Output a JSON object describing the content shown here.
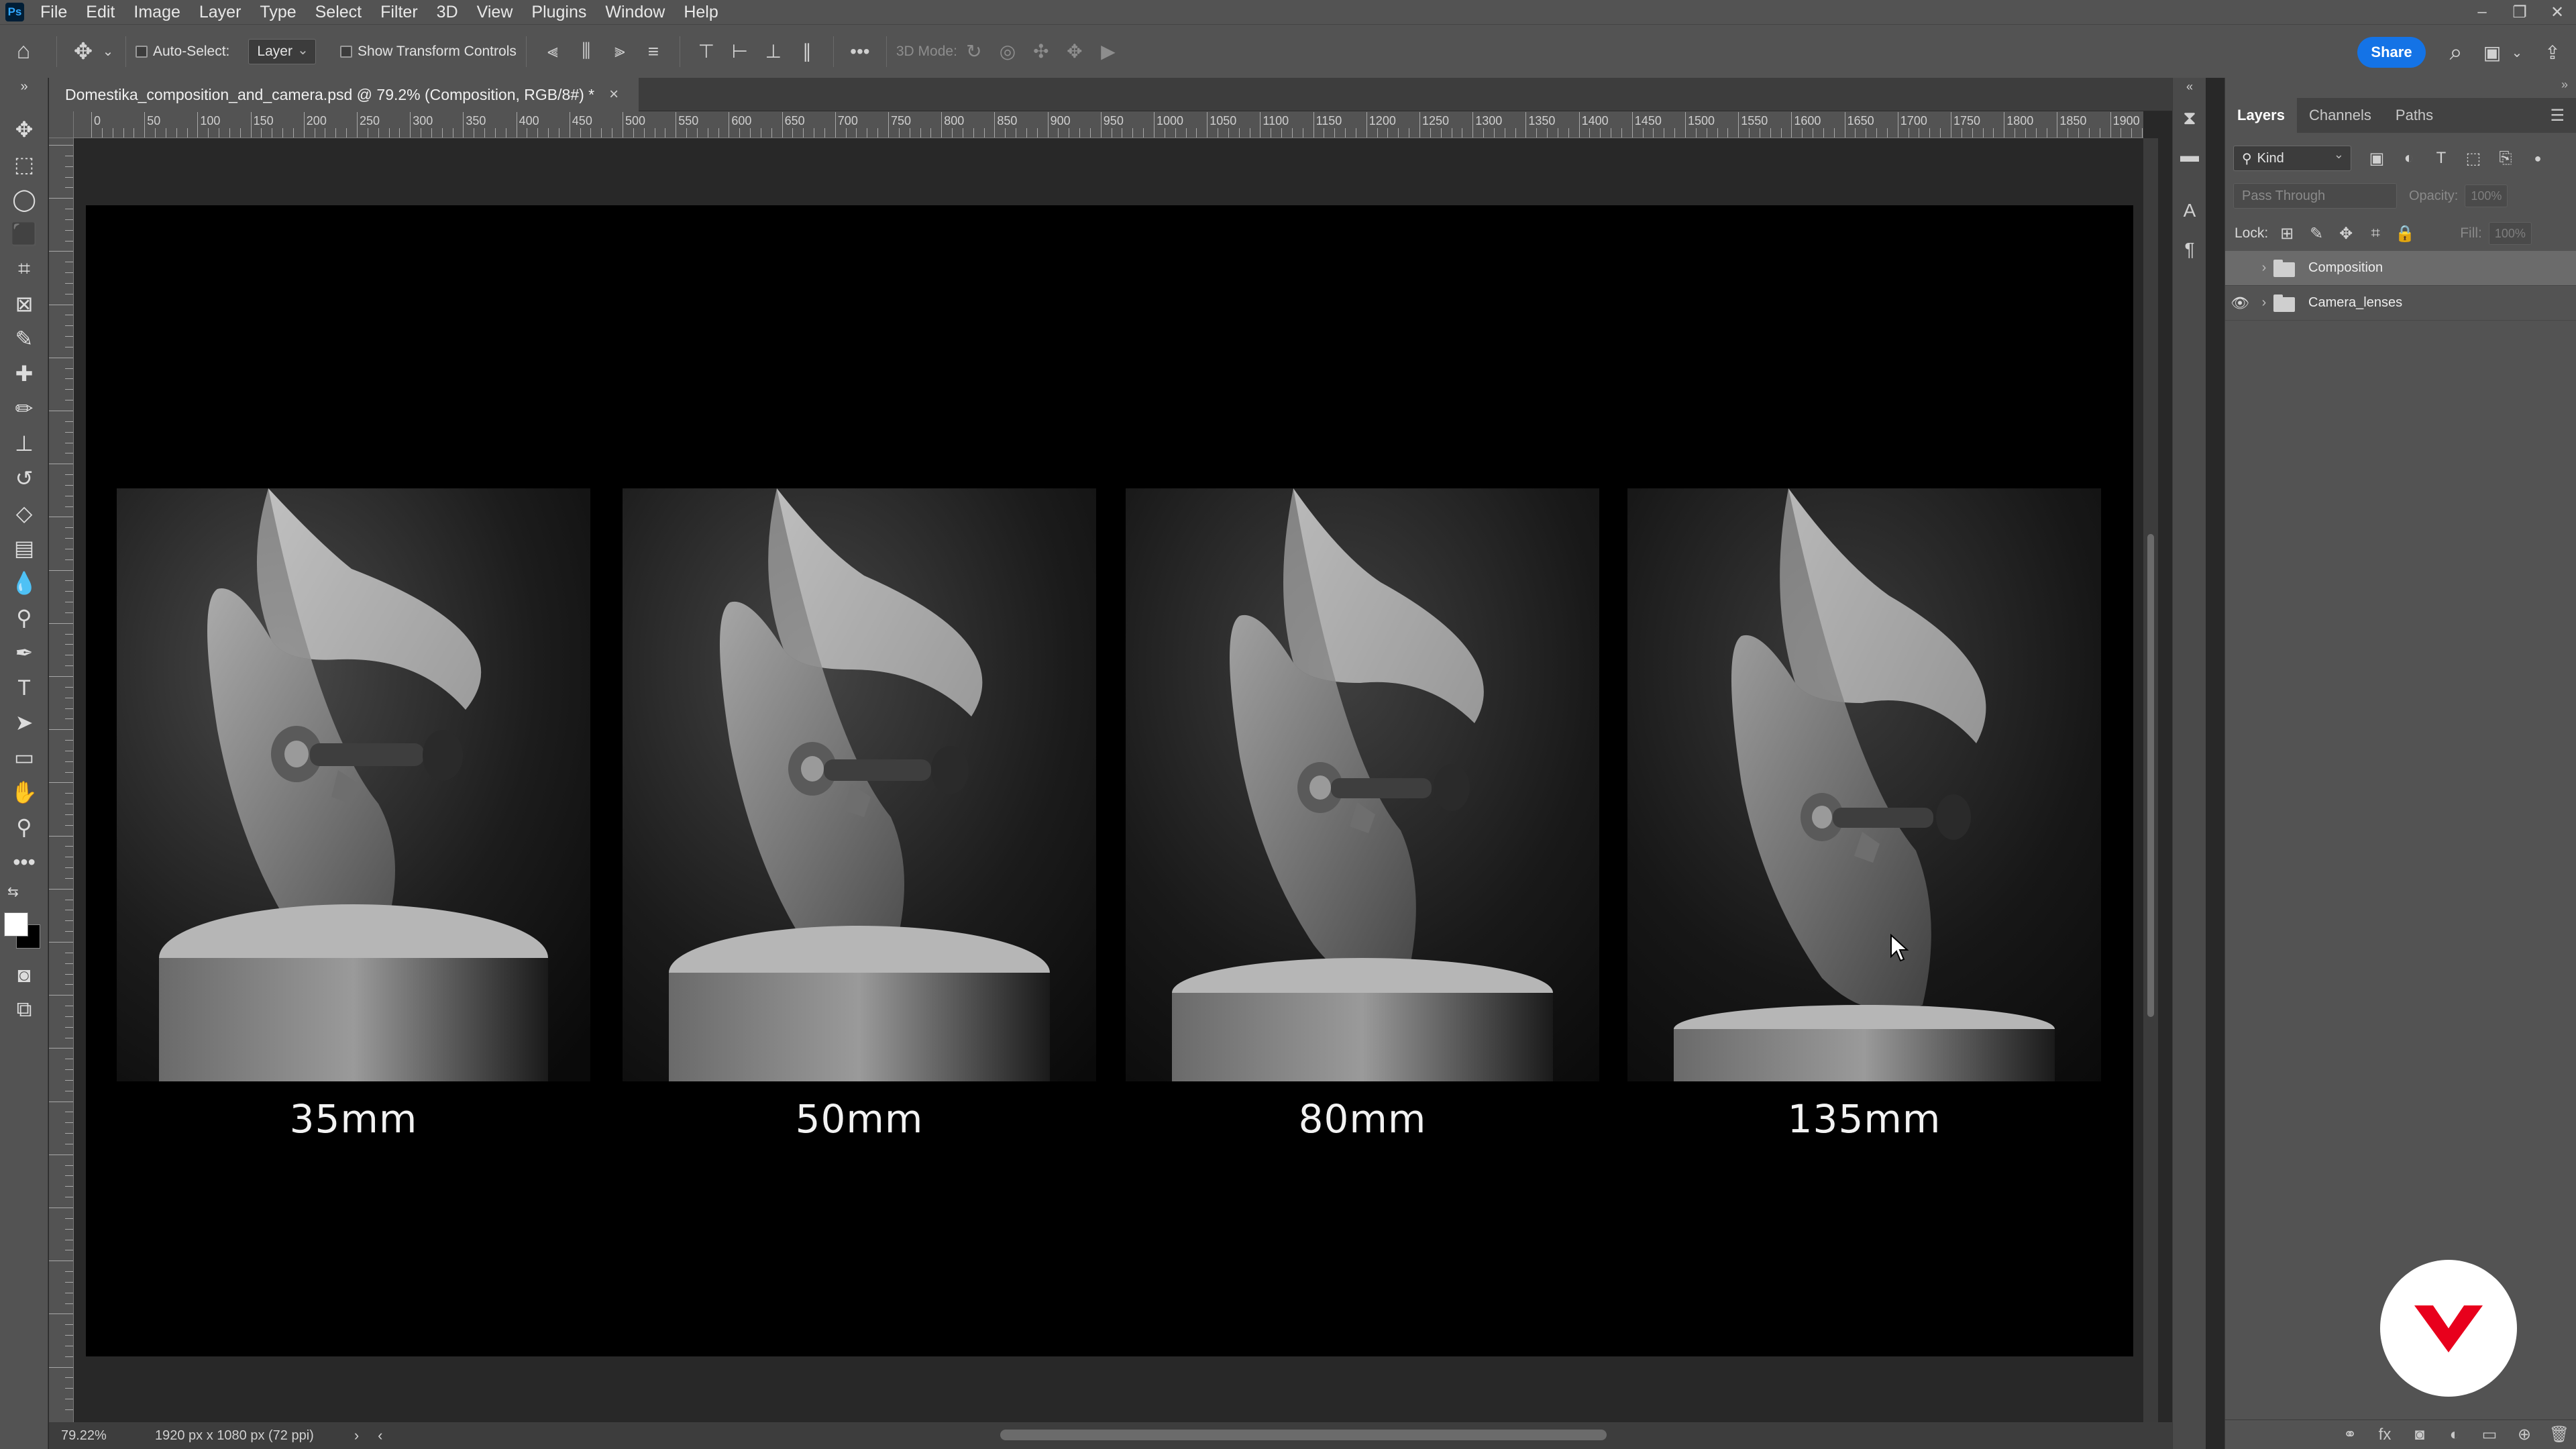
{
  "app": {
    "logo_text": "Ps",
    "menu": [
      "File",
      "Edit",
      "Image",
      "Layer",
      "Type",
      "Select",
      "Filter",
      "3D",
      "View",
      "Plugins",
      "Window",
      "Help"
    ]
  },
  "options_bar": {
    "auto_select_label": "Auto-Select:",
    "auto_select_target": "Layer",
    "show_transform_label": "Show Transform Controls",
    "mode_3d_label": "3D Mode:",
    "share_label": "Share"
  },
  "document": {
    "tab_title": "Domestika_composition_and_camera.psd @ 79.2% (Composition, RGB/8#) *",
    "close_glyph": "×",
    "zoom": "79.22%",
    "dimensions": "1920 px x 1080 px (72 ppi)",
    "ruler_labels": [
      "0",
      "50",
      "100",
      "150",
      "200",
      "250",
      "300",
      "350",
      "400",
      "450",
      "500",
      "550",
      "600",
      "650",
      "700",
      "750",
      "800",
      "850",
      "900",
      "950",
      "1000",
      "1050",
      "1100",
      "1150",
      "1200",
      "1250",
      "1300",
      "1350",
      "1400",
      "1450",
      "1500",
      "1550",
      "1600",
      "1650",
      "1700",
      "1750",
      "1800",
      "1850",
      "1900"
    ]
  },
  "artwork": {
    "frames": [
      {
        "caption": "35mm"
      },
      {
        "caption": "50mm"
      },
      {
        "caption": "80mm"
      },
      {
        "caption": "135mm"
      }
    ]
  },
  "layers_panel": {
    "tabs": [
      "Layers",
      "Channels",
      "Paths"
    ],
    "active_tab": "Layers",
    "kind_filter": "Kind",
    "blend_mode": "Pass Through",
    "opacity_label": "Opacity:",
    "opacity_value": "100%",
    "lock_label": "Lock:",
    "fill_label": "Fill:",
    "fill_value": "100%",
    "layers": [
      {
        "name": "Composition",
        "visible": false,
        "selected": true,
        "type": "group"
      },
      {
        "name": "Camera_lenses",
        "visible": true,
        "selected": false,
        "type": "group"
      }
    ]
  },
  "colors": {
    "accent": "#1473e6",
    "badge": "#e8001c",
    "chrome": "#535353",
    "artboard": "#000000"
  }
}
